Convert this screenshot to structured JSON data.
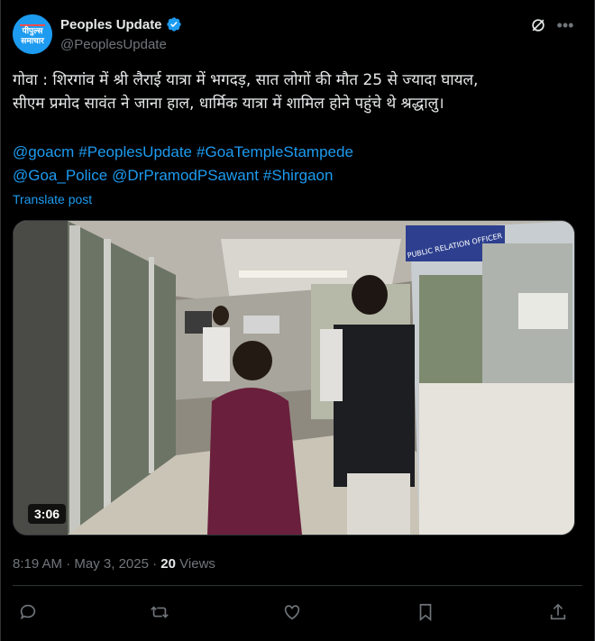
{
  "author": {
    "name": "Peoples Update",
    "handle": "@PeoplesUpdate",
    "avatar_text_line1": "पीपुल्स",
    "avatar_text_line2": "समाचार",
    "verified": true
  },
  "post": {
    "text_line1": "गोवा :  शिरगांव में श्री लैराई यात्रा में भगदड़,  सात लोगों की मौत 25 से ज्यादा घायल,",
    "text_line2": "सीएम प्रमोद सावंत ने जाना हाल, धार्मिक यात्रा में शामिल होने पहुंचे थे श्रद्धालु।",
    "hashtags_line1": [
      "@goacm",
      "#PeoplesUpdate",
      "#GoaTempleStampede"
    ],
    "hashtags_line2": [
      "@Goa_Police",
      "@DrPramodPSawant",
      "#Shirgaon"
    ],
    "translate_label": "Translate post"
  },
  "media": {
    "video_duration": "3:06",
    "sign_text": "PUBLIC RELATION OFFICER"
  },
  "meta": {
    "time": "8:19 AM",
    "separator": "·",
    "date": "May 3, 2025",
    "views_count": "20",
    "views_label": "Views"
  },
  "icons": {
    "reply": "reply-icon",
    "repost": "repost-icon",
    "like": "like-icon",
    "bookmark": "bookmark-icon",
    "share": "share-icon",
    "grok": "grok-icon",
    "more": "more-icon",
    "verified": "verified-badge-icon"
  },
  "colors": {
    "accent": "#1d9bf0",
    "text": "#e7e9ea",
    "muted": "#71767b",
    "background": "#000000"
  }
}
